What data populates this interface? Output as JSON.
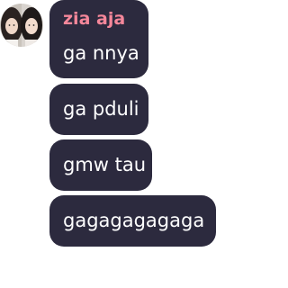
{
  "chat": {
    "sender_name": "zia aja",
    "avatar_icon": "profile-photo-two-people",
    "colors": {
      "bubble": "#2c2a3e",
      "sender_name": "#f5879a",
      "message_text": "#ffffff"
    },
    "messages": [
      {
        "text": "ga nnya"
      },
      {
        "text": "ga pduli"
      },
      {
        "text": "gmw tau"
      },
      {
        "text": "gagagagagaga"
      }
    ]
  }
}
